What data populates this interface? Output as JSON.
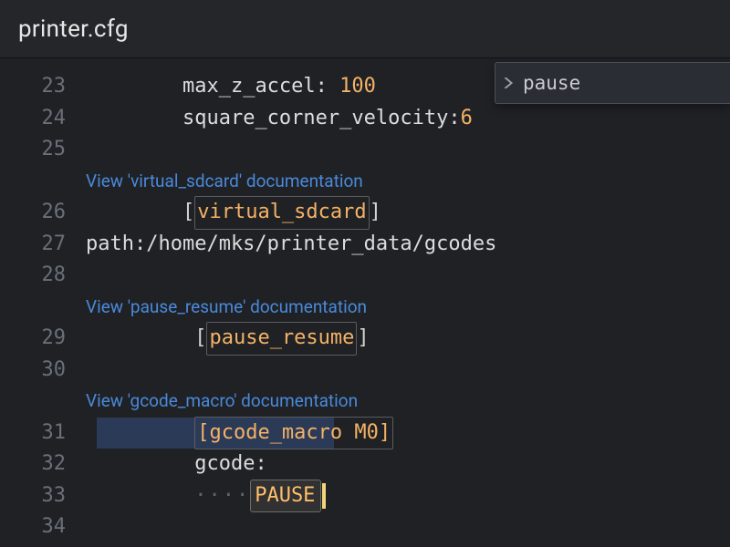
{
  "header": {
    "filename": "printer.cfg"
  },
  "crumb": {
    "label": "pause"
  },
  "lines": {
    "l23": {
      "n": "23",
      "key": "max_z_accel: ",
      "val": "100"
    },
    "l24": {
      "n": "24",
      "key": "square_corner_velocity:",
      "val": "6"
    },
    "l25": {
      "n": "25"
    },
    "cl_sd": {
      "label": "View 'virtual_sdcard' documentation"
    },
    "l26": {
      "n": "26",
      "lbracket": "[",
      "name": "virtual_sdcard",
      "rbracket": "]"
    },
    "l27": {
      "n": "27",
      "text": "path:/home/mks/printer_data/gcodes"
    },
    "l28": {
      "n": "28"
    },
    "cl_pr": {
      "label": "View 'pause_resume' documentation"
    },
    "l29": {
      "n": "29",
      "lbracket": "[",
      "name": "pause_resume",
      "rbracket": "]"
    },
    "l30": {
      "n": "30"
    },
    "cl_gm": {
      "label": "View 'gcode_macro' documentation"
    },
    "l31": {
      "n": "31",
      "text": "[gcode_macro M0]"
    },
    "l32": {
      "n": "32",
      "text": "gcode:"
    },
    "l33": {
      "n": "33",
      "ws": "····",
      "word": "PAUSE"
    },
    "l34": {
      "n": "34"
    }
  }
}
